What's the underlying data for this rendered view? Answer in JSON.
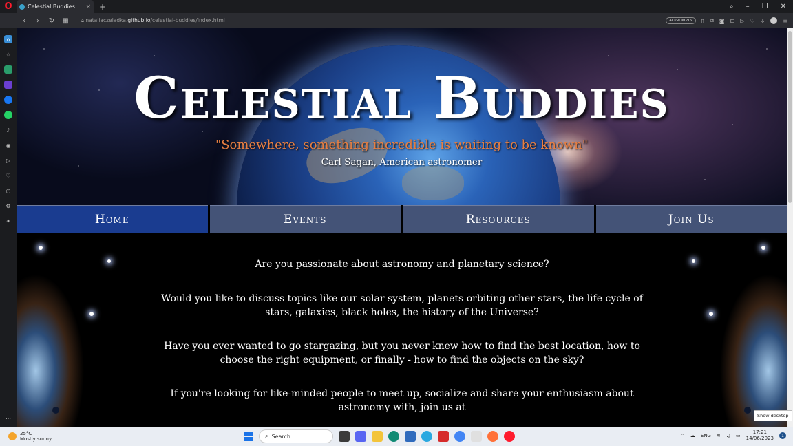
{
  "browser": {
    "tab_title": "Celestial Buddies",
    "tab_close": "×",
    "new_tab": "+",
    "url_prefix": "nataliaczeladka.",
    "url_host": "github.io",
    "url_path": "/celestial-buddies/index.html",
    "ai_prompts": "AI PROMPTS"
  },
  "hero": {
    "title": "Celestial Buddies",
    "quote": "\"Somewhere, something incredible is waiting to be known\"",
    "quote_author": "Carl Sagan, American astronomer"
  },
  "nav": {
    "items": [
      {
        "label": "Home",
        "active": true
      },
      {
        "label": "Events",
        "active": false
      },
      {
        "label": "Resources",
        "active": false
      },
      {
        "label": "Join Us",
        "active": false
      }
    ]
  },
  "content": {
    "paragraphs": [
      "Are you passionate about astronomy and planetary science?",
      "Would you like to discuss topics like our solar system, planets orbiting other stars, the life cycle of stars, galaxies, black holes, the history of the Universe?",
      "Have you ever wanted to go stargazing, but you never knew how to find the best location, how to choose the right equipment, or finally - how to find the objects on the sky?",
      "If you're looking for like-minded people to meet up, socialize and share your enthusiasm about astronomy with, join us at"
    ]
  },
  "taskbar": {
    "temperature": "25°C",
    "weather": "Mostly sunny",
    "search_placeholder": "Search",
    "language": "ENG",
    "time": "17:21",
    "date": "14/06/2023",
    "notifications": "1",
    "show_desktop": "Show desktop"
  },
  "colors": {
    "nav_active": "#1a3c90",
    "nav_inactive": "#445377",
    "quote": "#e77f43"
  }
}
